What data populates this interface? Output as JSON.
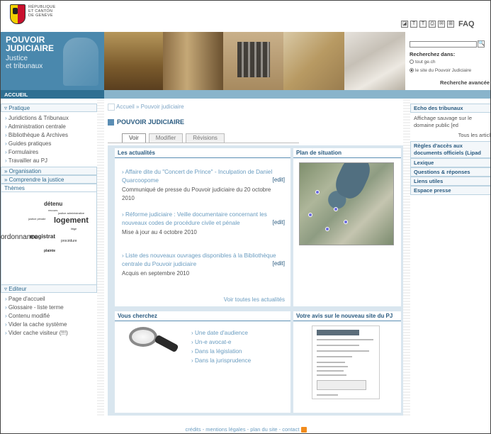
{
  "logo": {
    "line1": "RÉPUBLIQUE",
    "line2": "ET CANTON",
    "line3": "DE GENÈVE"
  },
  "toolbar": {
    "icons": [
      "a-minus-icon",
      "t-small-icon",
      "t-large-icon",
      "print-icon",
      "mail-icon",
      "sitemap-icon"
    ],
    "faq_label": "FAQ"
  },
  "brand": {
    "title_line1": "POUVOIR",
    "title_line2": "JUDICIAIRE",
    "sub_line1": "Justice",
    "sub_line2": "et tribunaux"
  },
  "search": {
    "label": "Recherchez dans:",
    "opt1": "tout ge.ch",
    "opt2": "le site du Pouvoir Judiciaire",
    "advanced": "Recherche avancée",
    "value": ""
  },
  "nav": {
    "home": "ACCUEIL"
  },
  "sidebar": {
    "pratique": "Pratique",
    "pratique_items": [
      "Juridictions & Tribunaux",
      "Administration centrale",
      "Bibliothèque & Archives",
      "Guides pratiques",
      "Formulaires",
      "Travailler au PJ"
    ],
    "organisation": "Organisation",
    "comprendre": "Comprendre la justice",
    "themes": "Thèmes",
    "tags": {
      "t1": "détenu",
      "t2": "justice administrative",
      "t3": "recours",
      "t4": "justice pénale",
      "t5": "logement",
      "t6": "litige",
      "t7": "ordonnance",
      "t8": "magistrat",
      "t9": "procédure",
      "t10": "plainte"
    },
    "editeur": "Editeur",
    "editeur_items": [
      "Page d'accueil",
      "Glossaire - liste terme",
      "Contenu modifié",
      "Vider la cache système",
      "Vider cache visiteur (!!!)"
    ]
  },
  "main": {
    "breadcrumb": "Accueil » Pouvoir judiciaire",
    "title": "POUVOIR JUDICIAIRE",
    "tabs": [
      "Voir",
      "Modifier",
      "Révisions"
    ],
    "news_header": "Les actualités",
    "news": [
      {
        "title": "Affaire dite du \"Concert de Prince\" - Inculpation de Daniel Quarcoopome",
        "edit": "[edit]",
        "sub": "Communiqué de presse du Pouvoir judiciaire du 20 octobre 2010"
      },
      {
        "title": "Réforme judiciaire : Veille documentaire concernant les nouveaux codes de procédure civile et pénale",
        "edit": "[edit]",
        "sub": "Mise à jour au 4 octobre 2010"
      },
      {
        "title": "Liste des nouveaux ouvrages disponibles à la Bibliothèque centrale du Pouvoir judiciaire",
        "edit": "[edit]",
        "sub": "Acquis en septembre 2010"
      }
    ],
    "see_all": "Voir toutes les actualités",
    "map_header": "Plan de situation",
    "search_header": "Vous cherchez",
    "search_links": [
      "Une date d'audience",
      "Un-e avocat-e",
      "Dans la législation",
      "Dans la jurisprudence"
    ],
    "survey_header": "Votre avis sur le nouveau site du PJ"
  },
  "right": {
    "echo": "Echo des tribunaux",
    "echo_text": "Affichage sauvage sur le domaine public",
    "echo_edit": "[ed",
    "all_articles": "Tous les articl",
    "regles": "Règles d'accès aux",
    "regles2": "documents officiels (Lipad",
    "lexique": "Lexique",
    "qr": "Questions & réponses",
    "liens": "Liens utiles",
    "presse": "Espace presse"
  },
  "footer": {
    "links": "crédits - mentions légales - plan du site - contact"
  },
  "colors": {
    "brand_blue": "#4a88ad",
    "nav_dark": "#2f6f92",
    "link": "#6a9cc0"
  }
}
